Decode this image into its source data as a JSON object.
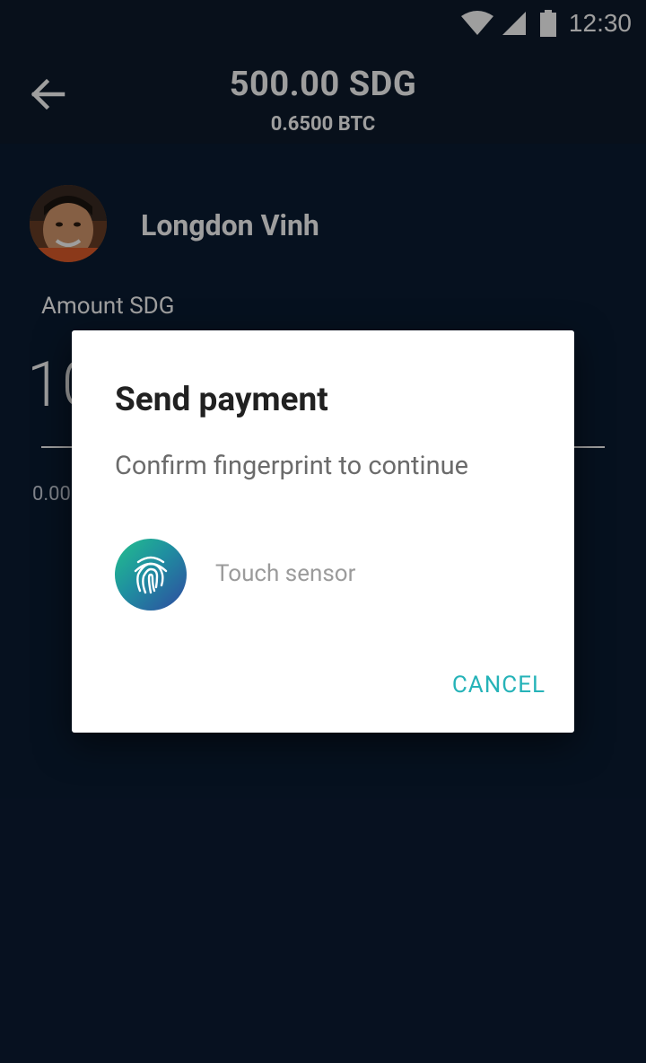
{
  "status_bar": {
    "time": "12:30"
  },
  "header": {
    "amount_primary": "500.00 SDG",
    "amount_secondary": "0.6500 BTC"
  },
  "contact": {
    "name": "Longdon Vinh"
  },
  "amount_field": {
    "label": "Amount SDG",
    "value": "10",
    "btc_preview": "0.00"
  },
  "dialog": {
    "title": "Send payment",
    "message": "Confirm fingerprint to continue",
    "sensor_label": "Touch sensor",
    "cancel_label": "CANCEL"
  },
  "colors": {
    "accent": "#26b3b8",
    "background": "#0b1c33",
    "toolbar": "#0d1a2c"
  }
}
